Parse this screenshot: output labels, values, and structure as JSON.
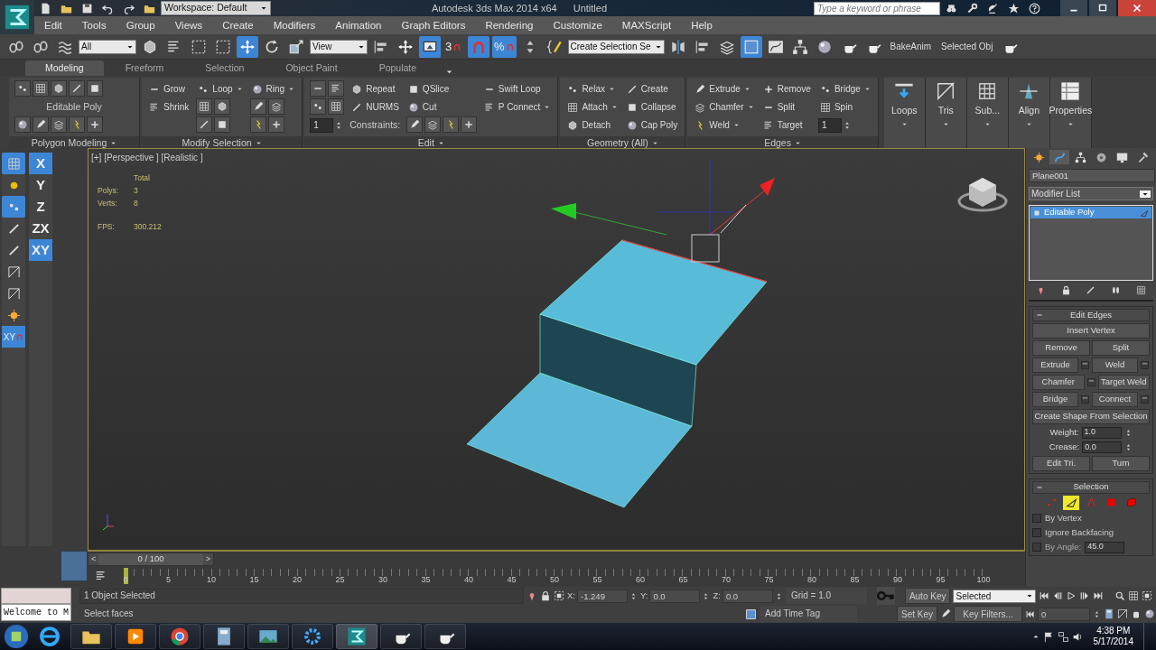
{
  "title_bar": {
    "workspace": "Workspace: Default",
    "app_title": "Autodesk 3ds Max 2014 x64",
    "document": "Untitled",
    "search": {
      "placeholder": "Type a keyword or phrase"
    }
  },
  "menu": [
    "Edit",
    "Tools",
    "Group",
    "Views",
    "Create",
    "Modifiers",
    "Animation",
    "Graph Editors",
    "Rendering",
    "Customize",
    "MAXScript",
    "Help"
  ],
  "main_toolbar": [
    {
      "kind": "tool",
      "on": false
    },
    {
      "kind": "tool",
      "on": false
    },
    {
      "kind": "tool",
      "on": false
    },
    {
      "kind": "dropdown",
      "value": "All"
    },
    {
      "kind": "tool",
      "on": false
    },
    {
      "kind": "tool",
      "on": false
    },
    {
      "kind": "tool",
      "on": false
    },
    {
      "kind": "tool",
      "on": false
    },
    {
      "kind": "tool",
      "on": true
    },
    {
      "kind": "tool",
      "on": false
    },
    {
      "kind": "tool",
      "on": false
    },
    {
      "kind": "dropdown",
      "value": "View"
    },
    {
      "kind": "tool",
      "on": false
    },
    {
      "kind": "tool",
      "on": false
    },
    {
      "kind": "tool",
      "on": true
    },
    {
      "kind": "tool",
      "on": false,
      "label": "3"
    },
    {
      "kind": "tool",
      "on": true
    },
    {
      "kind": "tool",
      "on": true,
      "label": "%"
    },
    {
      "kind": "tool",
      "on": false
    },
    {
      "kind": "tool",
      "on": false
    },
    {
      "kind": "dropdown",
      "value": "Create Selection Se"
    },
    {
      "kind": "tool",
      "on": false
    },
    {
      "kind": "tool",
      "on": false
    },
    {
      "kind": "tool",
      "on": false
    },
    {
      "kind": "tool",
      "on": true
    },
    {
      "kind": "tool",
      "on": false
    },
    {
      "kind": "tool",
      "on": false
    },
    {
      "kind": "tool",
      "on": false
    },
    {
      "kind": "tool",
      "on": false
    },
    {
      "kind": "tool",
      "on": false
    },
    {
      "kind": "text",
      "label": "BakeAnim"
    },
    {
      "kind": "text",
      "label": "Selected Obj"
    },
    {
      "kind": "tool",
      "on": false
    }
  ],
  "ribbon": {
    "tabs": [
      {
        "label": "Modeling",
        "selected": true
      },
      {
        "label": "Freeform",
        "selected": false
      },
      {
        "label": "Selection",
        "selected": false
      },
      {
        "label": "Object Paint",
        "selected": false
      },
      {
        "label": "Populate",
        "selected": false
      }
    ],
    "panels": [
      {
        "title": "Polygon Modeling",
        "columns": [
          [
            {
              "kind": "toolrow"
            },
            {
              "kind": "label",
              "label": "Editable Poly"
            },
            {
              "kind": "toolrow"
            }
          ]
        ]
      },
      {
        "title": "Modify Selection",
        "columns": [
          [
            {
              "kind": "button",
              "label": "Grow"
            },
            {
              "kind": "button",
              "label": "Shrink"
            }
          ],
          [
            {
              "kind": "split",
              "label": "Loop"
            },
            {
              "kind": "toolrow"
            },
            {
              "kind": "toolrow"
            }
          ],
          [
            {
              "kind": "split",
              "label": "Ring"
            },
            {
              "kind": "toolrow"
            },
            {
              "kind": "toolrow"
            }
          ]
        ]
      },
      {
        "title": "Edit",
        "columns": [
          [
            {
              "kind": "toolrow"
            },
            {
              "kind": "toolrow"
            },
            {
              "kind": "spinner",
              "value": "1"
            }
          ],
          [
            {
              "kind": "button",
              "label": "Repeat"
            },
            {
              "kind": "button",
              "label": "NURMS"
            },
            {
              "kind": "label",
              "label": "Constraints:"
            }
          ],
          [
            {
              "kind": "button",
              "label": "QSlice"
            },
            {
              "kind": "button",
              "label": "Cut"
            },
            {
              "kind": "toolrow"
            }
          ],
          [
            {
              "kind": "button",
              "label": "Swift Loop"
            },
            {
              "kind": "split",
              "label": "P Connect"
            }
          ]
        ]
      },
      {
        "title": "Geometry (All)",
        "columns": [
          [
            {
              "kind": "split",
              "label": "Relax"
            },
            {
              "kind": "split",
              "label": "Attach"
            },
            {
              "kind": "button",
              "label": "Detach"
            }
          ],
          [
            {
              "kind": "button",
              "label": "Create"
            },
            {
              "kind": "button",
              "label": "Collapse"
            },
            {
              "kind": "button",
              "label": "Cap Poly"
            }
          ]
        ]
      },
      {
        "title": "Edges",
        "columns": [
          [
            {
              "kind": "split",
              "label": "Extrude"
            },
            {
              "kind": "split",
              "label": "Chamfer"
            },
            {
              "kind": "split",
              "label": "Weld"
            }
          ],
          [
            {
              "kind": "button",
              "label": "Remove"
            },
            {
              "kind": "button",
              "label": "Split"
            },
            {
              "kind": "button",
              "label": "Target"
            }
          ],
          [
            {
              "kind": "split",
              "label": "Bridge"
            },
            {
              "kind": "button",
              "label": "Spin"
            },
            {
              "kind": "spinner",
              "value": "1"
            }
          ]
        ]
      }
    ],
    "large_buttons": [
      "Loops",
      "Tris",
      "Sub...",
      "Align",
      "Properties"
    ]
  },
  "snap_toggles": [
    {
      "on": true
    },
    {
      "on": false
    },
    {
      "on": true
    },
    {
      "on": false
    },
    {
      "on": false
    },
    {
      "on": false
    },
    {
      "on": false
    },
    {
      "on": false
    },
    {
      "on": true,
      "label": "XY"
    }
  ],
  "axis_constraints": [
    {
      "label": "X",
      "selected": true
    },
    {
      "label": "Y",
      "selected": false
    },
    {
      "label": "Z",
      "selected": false
    },
    {
      "label": "ZX",
      "selected": false
    },
    {
      "label": "XY",
      "selected": true
    }
  ],
  "viewport": {
    "label": "[+] [Perspective ] [Realistic ]",
    "stats_header": "Total",
    "stats": [
      {
        "name": "Polys:",
        "value": "3"
      },
      {
        "name": "Verts:",
        "value": "8"
      }
    ],
    "fps": {
      "name": "FPS:",
      "value": "300.212"
    }
  },
  "command_panel": {
    "tabs": [
      {
        "selected": false
      },
      {
        "selected": true
      },
      {
        "selected": false
      },
      {
        "selected": false
      },
      {
        "selected": false
      },
      {
        "selected": false
      }
    ],
    "object_name": "Plane001",
    "modifier_list": "Modifier List",
    "stack": [
      {
        "label": "Editable Poly",
        "selected": true
      }
    ],
    "edit_edges": {
      "title": "Edit Edges",
      "rows": [
        [
          {
            "label": "Insert Vertex",
            "settings": false
          }
        ],
        [
          {
            "label": "Remove",
            "settings": false
          },
          {
            "label": "Split",
            "settings": false
          }
        ],
        [
          {
            "label": "Extrude",
            "settings": true
          },
          {
            "label": "Weld",
            "settings": true
          }
        ],
        [
          {
            "label": "Chamfer",
            "settings": true
          },
          {
            "label": "Target Weld",
            "settings": false
          }
        ],
        [
          {
            "label": "Bridge",
            "settings": true
          },
          {
            "label": "Connect",
            "settings": true
          }
        ],
        [
          {
            "label": "Create Shape From Selection",
            "settings": false
          }
        ]
      ],
      "spinners": [
        {
          "label": "Weight:",
          "value": "1.0"
        },
        {
          "label": "Crease:",
          "value": "0.0"
        }
      ],
      "bottom_buttons": [
        "Edit Tri.",
        "Turn"
      ]
    },
    "selection": {
      "title": "Selection",
      "levels": [
        {
          "selected": false
        },
        {
          "selected": true
        },
        {
          "selected": false
        },
        {
          "selected": false
        },
        {
          "selected": false
        }
      ],
      "options": [
        {
          "label": "By Vertex",
          "checked": false,
          "disabled": false
        },
        {
          "label": "Ignore Backfacing",
          "checked": false,
          "disabled": false
        },
        {
          "label": "By Angle:",
          "checked": false,
          "disabled": true,
          "value": "45.0"
        }
      ]
    }
  },
  "timeline": {
    "frame_display": "0 / 100",
    "prev": "<",
    "next": ">",
    "level": 0,
    "ticks": [
      "0",
      "5",
      "10",
      "15",
      "20",
      "25",
      "30",
      "35",
      "40",
      "45",
      "50",
      "55",
      "60",
      "65",
      "70",
      "75",
      "80",
      "85",
      "90",
      "95",
      "100"
    ]
  },
  "status": {
    "listener": "Welcome to M",
    "prompt": "1 Object Selected",
    "hint": "Select faces",
    "coords": [
      {
        "axis": "X:",
        "value": "-1.249"
      },
      {
        "axis": "Y:",
        "value": "0.0"
      },
      {
        "axis": "Z:",
        "value": "0.0"
      }
    ],
    "grid": "Grid = 1.0",
    "add_time_tag": "Add Time Tag",
    "auto_key": "Auto Key",
    "key_mode": "Selected",
    "set_key": "Set Key",
    "key_filters": "Key Filters...",
    "current_frame": "0"
  },
  "taskbar": {
    "time": "4:38 PM",
    "date": "5/17/2014"
  }
}
